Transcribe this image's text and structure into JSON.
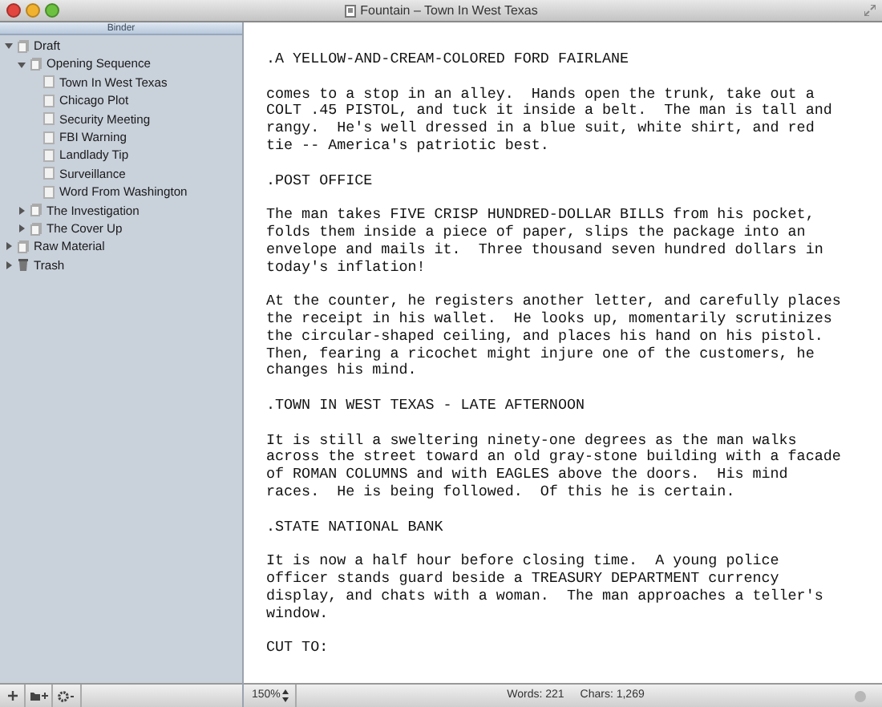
{
  "window": {
    "title": "Fountain – Town In West Texas"
  },
  "binder": {
    "header": "Binder",
    "items": [
      {
        "label": "Draft",
        "kind": "draft",
        "expanded": true,
        "children": [
          {
            "label": "Opening Sequence",
            "kind": "folder",
            "expanded": true,
            "children": [
              {
                "label": "Town In West Texas",
                "kind": "document"
              },
              {
                "label": "Chicago Plot",
                "kind": "document"
              },
              {
                "label": "Security Meeting",
                "kind": "document"
              },
              {
                "label": "FBI Warning",
                "kind": "document"
              },
              {
                "label": "Landlady Tip",
                "kind": "document"
              },
              {
                "label": "Surveillance",
                "kind": "document"
              },
              {
                "label": "Word From Washington",
                "kind": "document"
              }
            ]
          },
          {
            "label": "The Investigation",
            "kind": "folder",
            "expanded": false
          },
          {
            "label": "The Cover Up",
            "kind": "folder",
            "expanded": false
          }
        ]
      },
      {
        "label": "Raw Material",
        "kind": "folder",
        "expanded": false
      },
      {
        "label": "Trash",
        "kind": "trash",
        "expanded": false
      }
    ]
  },
  "editor": {
    "blocks": [
      {
        "lines": [
          ".A YELLOW-AND-CREAM-COLORED FORD FAIRLANE"
        ]
      },
      {
        "lines": [
          "comes to a stop in an alley.  Hands open the trunk, take out a",
          "COLT .45 PISTOL, and tuck it inside a belt.  The man is tall and",
          "rangy.  He's well dressed in a blue suit, white shirt, and red",
          "tie -- America's patriotic best."
        ]
      },
      {
        "lines": [
          ".POST OFFICE"
        ]
      },
      {
        "lines": [
          "The man takes FIVE CRISP HUNDRED-DOLLAR BILLS from his pocket,",
          "folds them inside a piece of paper, slips the package into an",
          "envelope and mails it.  Three thousand seven hundred dollars in",
          "today's inflation!"
        ]
      },
      {
        "lines": [
          "At the counter, he registers another letter, and carefully places",
          "the receipt in his wallet.  He looks up, momentarily scrutinizes",
          "the circular-shaped ceiling, and places his hand on his pistol.",
          "Then, fearing a ricochet might injure one of the customers, he",
          "changes his mind."
        ]
      },
      {
        "lines": [
          ".TOWN IN WEST TEXAS - LATE AFTERNOON"
        ]
      },
      {
        "lines": [
          "It is still a sweltering ninety-one degrees as the man walks",
          "across the street toward an old gray-stone building with a facade",
          "of ROMAN COLUMNS and with EAGLES above the doors.  His mind",
          "races.  He is being followed.  Of this he is certain."
        ]
      },
      {
        "lines": [
          ".STATE NATIONAL BANK"
        ]
      },
      {
        "lines": [
          "It is now a half hour before closing time.  A young police",
          "officer stands guard beside a TREASURY DEPARTMENT currency",
          "display, and chats with a woman.  The man approaches a teller's",
          "window."
        ]
      },
      {
        "lines": [
          "CUT TO:"
        ]
      }
    ]
  },
  "status_bar": {
    "zoom": "150%",
    "words": "Words: 221",
    "chars": "Chars: 1,269"
  }
}
